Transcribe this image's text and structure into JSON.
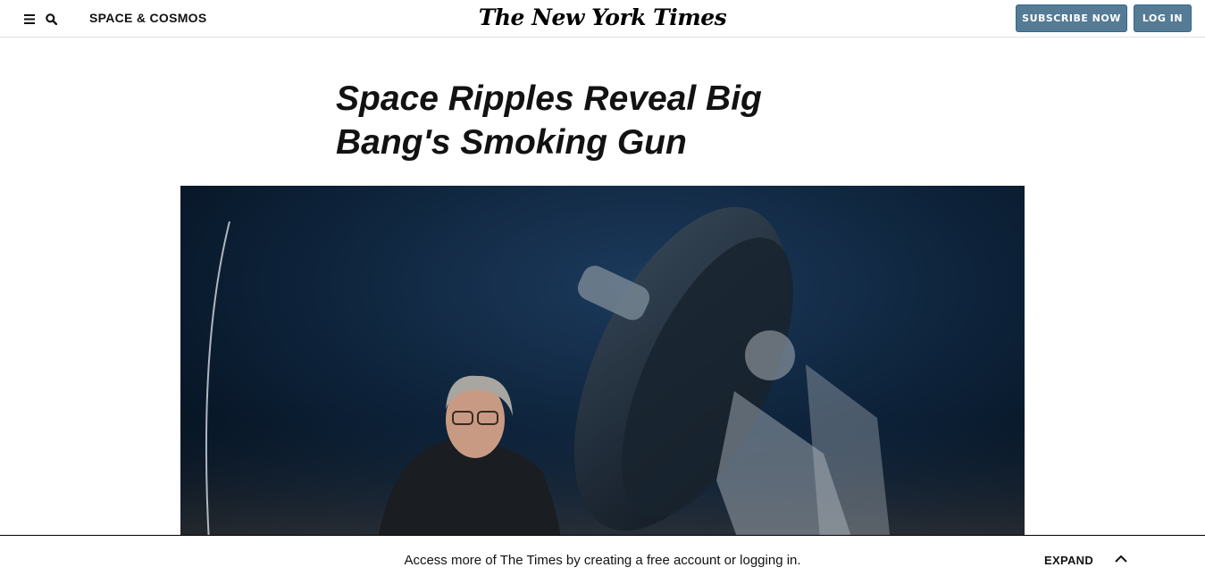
{
  "header": {
    "section_label": "SPACE & COSMOS",
    "masthead": "The New York Times",
    "subscribe_label": "SUBSCRIBE NOW",
    "login_label": "LOG IN"
  },
  "article": {
    "headline": "Space Ripples Reveal Big Bang's Smoking Gun"
  },
  "banner": {
    "text": "Access more of The Times by creating a free account or logging in.",
    "expand_label": "EXPAND"
  },
  "colors": {
    "button_bg": "#567b95",
    "image_bg": "#05111d"
  },
  "icons": [
    "menu-icon",
    "search-icon",
    "chevron-up-icon"
  ]
}
